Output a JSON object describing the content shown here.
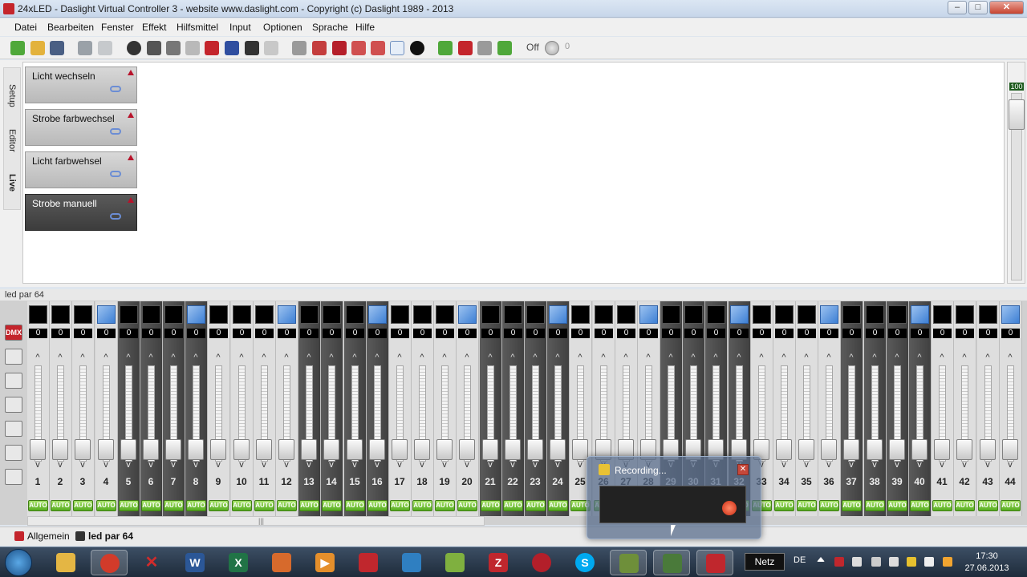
{
  "window": {
    "title": "24xLED - Daslight Virtual Controller 3  -  website www.daslight.com  -  Copyright (c) Daslight 1989 - 2013",
    "minimize": "–",
    "maximize": "□",
    "close": "✕"
  },
  "menu": [
    "Datei",
    "Bearbeiten",
    "Fenster",
    "Effekt",
    "Hilfsmittel",
    "Input",
    "Optionen",
    "Sprache",
    "Hilfe"
  ],
  "toolbar": {
    "off_label": "Off",
    "counter": "0"
  },
  "side_tabs": [
    "Setup",
    "Editor",
    "Live"
  ],
  "scenes": [
    "Licht wechseln",
    "Strobe farbwechsel",
    "Licht farbwehsel",
    "Strobe manuell"
  ],
  "master": {
    "value": "100"
  },
  "panel_title": "led par 64",
  "left_tools": {
    "dmx_label": "DMX"
  },
  "channels": {
    "numbers": [
      "1",
      "2",
      "3",
      "4",
      "5",
      "6",
      "7",
      "8",
      "9",
      "10",
      "11",
      "12",
      "13",
      "14",
      "15",
      "16",
      "17",
      "18",
      "19",
      "20",
      "21",
      "22",
      "23",
      "24",
      "25",
      "26",
      "27",
      "28",
      "29",
      "30",
      "31",
      "32",
      "33",
      "34",
      "35",
      "36",
      "37",
      "38",
      "39",
      "40",
      "41",
      "42",
      "43",
      "44"
    ],
    "value": "0",
    "auto_label": "AUTO",
    "up_glyph": "^",
    "down_glyph": "v"
  },
  "doc_tabs": [
    "Allgemein",
    "led par 64"
  ],
  "recording": {
    "title": "Recording...",
    "close": "✕"
  },
  "taskbar": {
    "netz": "Netz",
    "lang": "DE",
    "time": "17:30",
    "date": "27.06.2013"
  },
  "colors": {
    "accent_red": "#c4252c",
    "auto_green": "#55ac1f",
    "selected_blue": "#3d7fd4"
  }
}
